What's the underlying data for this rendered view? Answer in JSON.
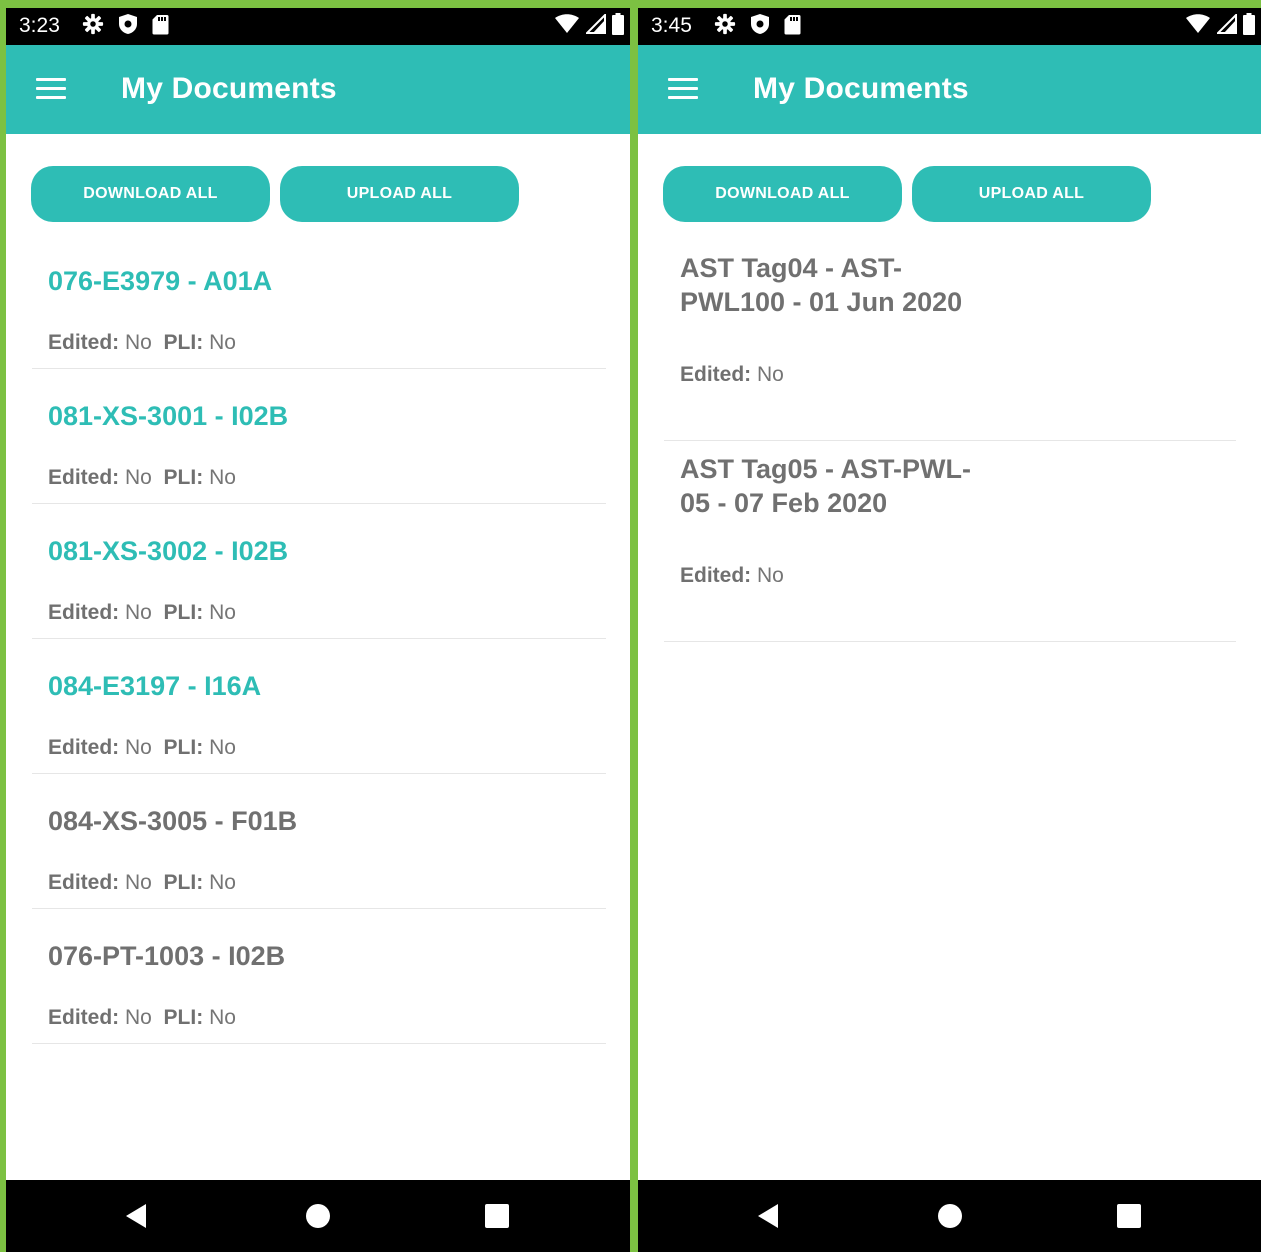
{
  "screens": [
    {
      "status_bar": {
        "time": "3:23"
      },
      "app_bar": {
        "title": "My Documents"
      },
      "actions": {
        "download_all": "DOWNLOAD ALL",
        "upload_all": "UPLOAD ALL"
      },
      "documents": [
        {
          "title": "076-E3979 - A01A",
          "color": "#2ebdb5",
          "edited_label": "Edited:",
          "edited_value": "No",
          "pli_label": "PLI:",
          "pli_value": "No"
        },
        {
          "title": "081-XS-3001 - I02B",
          "color": "#2ebdb5",
          "edited_label": "Edited:",
          "edited_value": "No",
          "pli_label": "PLI:",
          "pli_value": "No"
        },
        {
          "title": "081-XS-3002 - I02B",
          "color": "#2ebdb5",
          "edited_label": "Edited:",
          "edited_value": "No",
          "pli_label": "PLI:",
          "pli_value": "No"
        },
        {
          "title": "084-E3197 - I16A",
          "color": "#2ebdb5",
          "edited_label": "Edited:",
          "edited_value": "No",
          "pli_label": "PLI:",
          "pli_value": "No"
        },
        {
          "title": "084-XS-3005 - F01B",
          "color": "#707070",
          "edited_label": "Edited:",
          "edited_value": "No",
          "pli_label": "PLI:",
          "pli_value": "No"
        },
        {
          "title": "076-PT-1003 - I02B",
          "color": "#707070",
          "edited_label": "Edited:",
          "edited_value": "No",
          "pli_label": "PLI:",
          "pli_value": "No"
        }
      ]
    },
    {
      "status_bar": {
        "time": "3:45"
      },
      "app_bar": {
        "title": "My Documents"
      },
      "actions": {
        "download_all": "DOWNLOAD ALL",
        "upload_all": "UPLOAD ALL"
      },
      "documents": [
        {
          "title": "AST Tag04 - AST-PWL100 - 01 Jun 2020",
          "color": "#707070",
          "edited_label": "Edited:",
          "edited_value": "No"
        },
        {
          "title": "AST Tag05 - AST-PWL-05 - 07 Feb 2020",
          "color": "#707070",
          "edited_label": "Edited:",
          "edited_value": "No"
        }
      ]
    }
  ],
  "colors": {
    "accent": "#2ebdb5",
    "inactive_title": "#707070",
    "frame": "#7cc142"
  },
  "icons": [
    "gear-icon",
    "shield-icon",
    "sd-card-icon",
    "wifi-icon",
    "signal-icon",
    "battery-icon",
    "hamburger-menu-icon",
    "back-icon",
    "home-icon",
    "recents-icon"
  ]
}
